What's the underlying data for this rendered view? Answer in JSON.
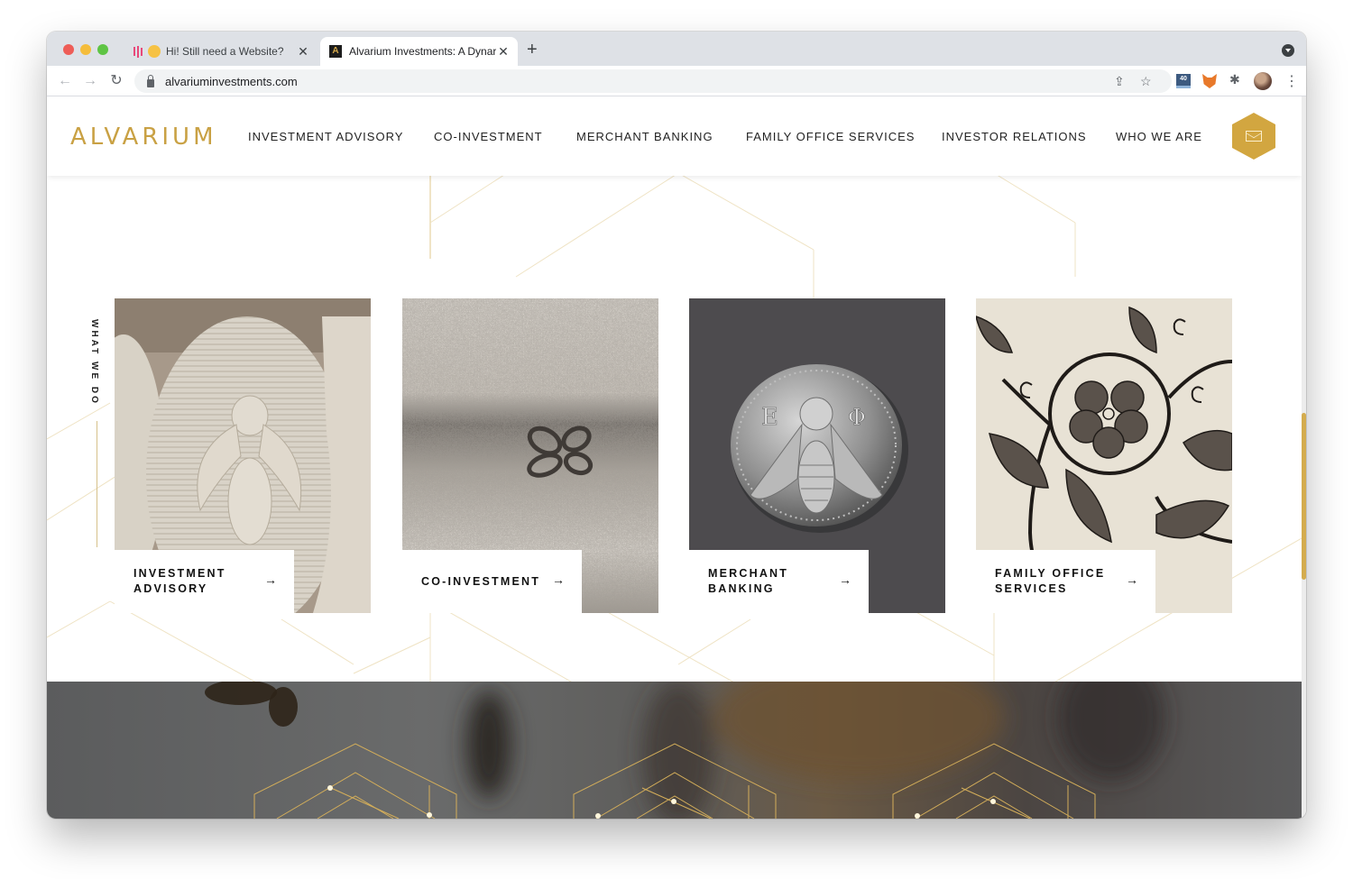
{
  "browser": {
    "tabs": [
      {
        "title": "Hi! Still need a Website?",
        "active": false,
        "favicon": "bars-hand-icon"
      },
      {
        "title": "Alvarium Investments: A Dynar",
        "active": true,
        "favicon": "alvarium-a-icon"
      }
    ],
    "close_glyph": "✕",
    "new_tab_glyph": "+",
    "url": "alvariuminvestments.com",
    "nav_glyphs": {
      "back": "←",
      "forward": "→",
      "reload": "↻"
    },
    "toolbar_glyphs": {
      "share": "⇪",
      "bookmark": "☆",
      "puzzle": "✱",
      "menu": "⋮"
    },
    "extension_badge": "40"
  },
  "site": {
    "logo": "ALVARIUM",
    "nav": [
      "INVESTMENT ADVISORY",
      "CO-INVESTMENT",
      "MERCHANT BANKING",
      "FAMILY OFFICE SERVICES",
      "INVESTOR RELATIONS",
      "WHO WE ARE"
    ],
    "accent_color": "#d2a640",
    "section_label": "WHAT WE DO",
    "cards": [
      {
        "label": "INVESTMENT\nADVISORY",
        "arrow": "→",
        "image": "carved-stone-bee"
      },
      {
        "label": "CO-INVESTMENT",
        "arrow": "→",
        "image": "stamped-metal-bee-mark"
      },
      {
        "label": "MERCHANT\nBANKING",
        "arrow": "→",
        "image": "ancient-silver-bee-coin"
      },
      {
        "label": "FAMILY OFFICE\nSERVICES",
        "arrow": "→",
        "image": "embroidered-floral-pattern"
      }
    ]
  }
}
